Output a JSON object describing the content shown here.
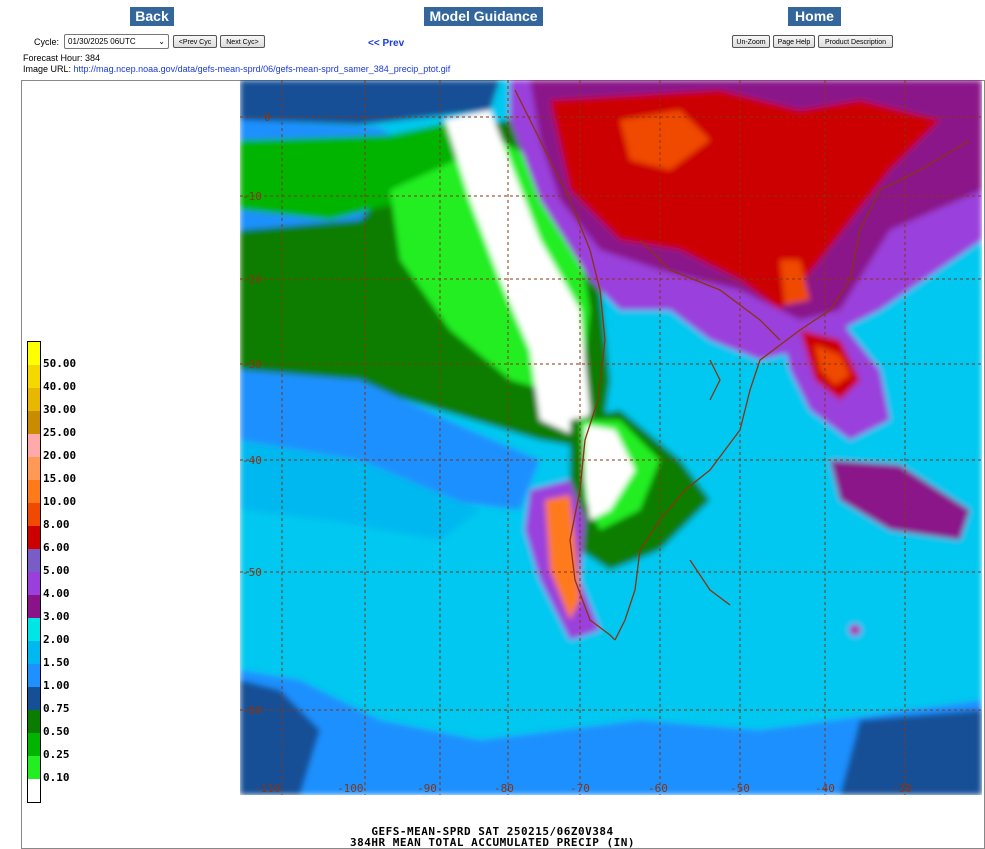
{
  "header": {
    "back_label": "Back",
    "guidance_label": "Model Guidance",
    "home_label": "Home"
  },
  "controls": {
    "cycle_label": "Cycle:",
    "cycle_value": "01/30/2025 06UTC",
    "prev_cyc_label": "<Prev Cyc",
    "next_cyc_label": "Next Cyc>",
    "prev_link_label": "<< Prev",
    "unzoom_label": "Un-Zoom",
    "page_help_label": "Page Help",
    "product_desc_label": "Product Description"
  },
  "info": {
    "forecast_hour_text": "Forecast Hour: 384",
    "image_url_label": "Image URL:",
    "image_url": "http://mag.ncep.noaa.gov/data/gefs-mean-sprd/06/gefs-mean-sprd_samer_384_precip_ptot.gif"
  },
  "map": {
    "lon_labels": [
      "-110",
      "-100",
      "-90",
      "-80",
      "-70",
      "-60",
      "-50",
      "-40",
      "-30"
    ],
    "lat_labels": [
      "0",
      "-10",
      "-20",
      "-30",
      "-40",
      "-50",
      "-60"
    ],
    "footer_line1": "GEFS-MEAN-SPRD SAT 250215/06Z0V384",
    "footer_line2": "384HR MEAN TOTAL ACCUMULATED PRECIP (IN)"
  },
  "legend": {
    "labels": [
      "50.00",
      "40.00",
      "30.00",
      "25.00",
      "20.00",
      "15.00",
      "10.00",
      "8.00",
      "6.00",
      "5.00",
      "4.00",
      "3.00",
      "2.00",
      "1.50",
      "1.00",
      "0.75",
      "0.50",
      "0.25",
      "0.10"
    ],
    "colors": [
      "#ffff00",
      "#f5d800",
      "#e8b800",
      "#c98c00",
      "#ffaaaa",
      "#ff9955",
      "#ff7a1a",
      "#f04a00",
      "#cc0000",
      "#7a5cc7",
      "#9a3fdc",
      "#8a138a",
      "#00e5e5",
      "#00b8f0",
      "#1e90ff",
      "#154f96",
      "#0a7d00",
      "#00b400",
      "#22ee22",
      "#ffffff"
    ]
  },
  "colors": {
    "button_bg": "#33669b",
    "link": "#1a3ad6",
    "grid": "#8a3410"
  }
}
